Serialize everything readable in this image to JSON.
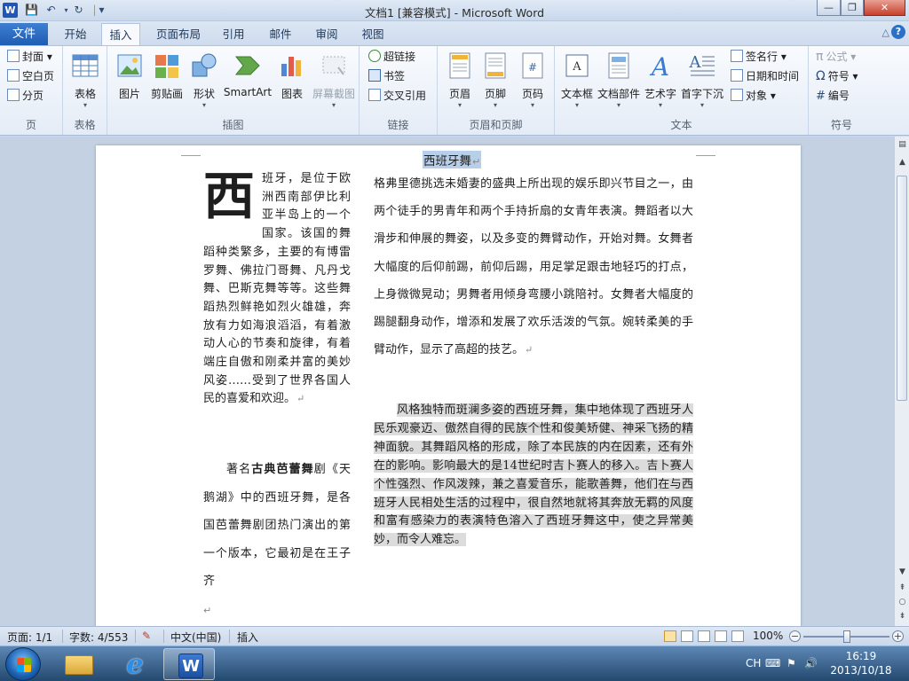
{
  "titlebar": {
    "title": "文档1 [兼容模式] - Microsoft Word",
    "app_logo": "W",
    "qat_save": "💾",
    "qat_undo": "↶",
    "qat_redo": "↻",
    "qat_customize": "▾",
    "min": "—",
    "max": "❐",
    "close": "✕"
  },
  "tabs": {
    "file": "文件",
    "items": [
      "开始",
      "插入",
      "页面布局",
      "引用",
      "邮件",
      "审阅",
      "视图"
    ],
    "active": "插入",
    "minimize": "△",
    "help": "?"
  },
  "ribbon": {
    "pages": {
      "name": "页",
      "cover": "封面",
      "blank": "空白页",
      "break": "分页"
    },
    "tables": {
      "name": "表格",
      "table": "表格"
    },
    "illustrations": {
      "name": "插图",
      "picture": "图片",
      "clipart": "剪贴画",
      "shapes": "形状",
      "smartart": "SmartArt",
      "chart": "图表",
      "screenshot": "屏幕截图"
    },
    "links": {
      "name": "链接",
      "hyperlink": "超链接",
      "bookmark": "书签",
      "crossref": "交叉引用"
    },
    "headerfooter": {
      "name": "页眉和页脚",
      "header": "页眉",
      "footer": "页脚",
      "pagenum": "页码"
    },
    "text": {
      "name": "文本",
      "textbox": "文本框",
      "quickparts": "文档部件",
      "wordart": "艺术字",
      "dropcap": "首字下沉",
      "signature": "签名行",
      "datetime": "日期和时间",
      "object": "对象"
    },
    "symbols": {
      "name": "符号",
      "equation": "公式",
      "symbol": "符号",
      "number": "编号",
      "equation_icon": "π",
      "symbol_icon": "Ω",
      "number_icon": "#"
    }
  },
  "document": {
    "title": "西班牙舞",
    "return_mark": "↵",
    "col1": {
      "dropcap": "西",
      "p1": "班牙，是位于欧洲西南部伊比利亚半岛上的一个国家。该国的舞蹈种类繁多，主要的有博雷罗舞、佛拉门哥舞、凡丹戈舞、巴斯克舞等等。这些舞蹈热烈鲜艳如烈火雄雄，奔放有力如海浪滔滔，有着激动人心的节奏和旋律，有着端庄自傲和刚柔并富的美妙风姿……受到了世界各国人民的喜爱和欢迎。",
      "p2_a": "著名",
      "p2_b": "古典芭蕾舞",
      "p2_c": "剧《天鹅湖》中的西班牙舞，是各国芭蕾舞剧团热门演出的第一个版本，它最初是在王子齐"
    },
    "col2": {
      "p1": "格弗里德挑选未婚妻的盛典上所出现的娱乐即兴节目之一，由两个徒手的男青年和两个手持折扇的女青年表演。舞蹈者以大滑步和伸展的舞姿，以及多变的舞臂动作，开始对舞。女舞者大幅度的后仰前踢，前仰后踢，用足掌足跟击地轻巧的打点，上身微微晃动；男舞者用倾身弯腰小跳陪衬。女舞者大幅度的踢腿翻身动作，增添和发展了欢乐活泼的气氛。婉转柔美的手臂动作，显示了高超的技艺。",
      "p2": "风格独特而斑澜多姿的西班牙舞，集中地体现了西班牙人民乐观豪迈、傲然自得的民族个性和俊美矫健、神采飞扬的精神面貌。其舞蹈风格的形成，除了本民族的内在因素，还有外在的影响。影响最大的是14世纪时吉卜赛人的移入。吉卜赛人个性强烈、作风泼辣，兼之喜爱音乐，能歌善舞，他们在与西班牙人民相处生活的过程中，很自然地就将其奔放无羁的风度和富有感染力的表演特色溶入了西班牙舞这中，使之异常美妙，而令人难忘。"
    }
  },
  "statusbar": {
    "page": "页面: 1/1",
    "words": "字数: 4/553",
    "language": "中文(中国)",
    "mode": "插入",
    "zoom": "100%",
    "zoom_level": 1.0
  },
  "taskbar": {
    "tray_lang": "CH",
    "tray_keyboard": "⌨",
    "tray_flag": "⚑",
    "tray_volume": "🔊",
    "time": "16:19",
    "date": "2013/10/18"
  }
}
